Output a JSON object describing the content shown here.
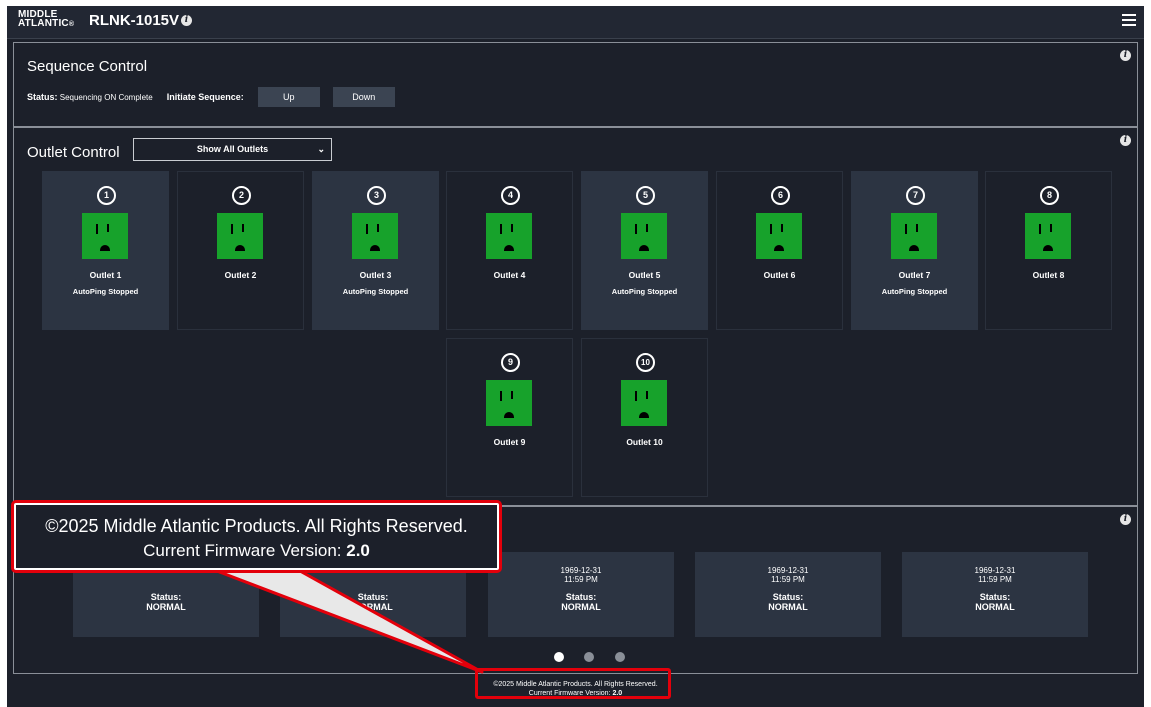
{
  "header": {
    "logo_line1": "MIDDLE",
    "logo_line2": "ATLANTIC",
    "logo_suffix": "®",
    "device_name": "RLNK-1015V"
  },
  "sequence": {
    "title": "Sequence Control",
    "status_label": "Status:",
    "status_value": "Sequencing ON Complete",
    "initiate_label": "Initiate Sequence:",
    "up_label": "Up",
    "down_label": "Down"
  },
  "outlet_control": {
    "title": "Outlet Control",
    "filter_selected": "Show All Outlets",
    "outlets": [
      {
        "num": "1",
        "name": "Outlet 1",
        "status": "AutoPing Stopped"
      },
      {
        "num": "2",
        "name": "Outlet 2",
        "status": ""
      },
      {
        "num": "3",
        "name": "Outlet 3",
        "status": "AutoPing Stopped"
      },
      {
        "num": "4",
        "name": "Outlet 4",
        "status": ""
      },
      {
        "num": "5",
        "name": "Outlet 5",
        "status": "AutoPing Stopped"
      },
      {
        "num": "6",
        "name": "Outlet 6",
        "status": ""
      },
      {
        "num": "7",
        "name": "Outlet 7",
        "status": "AutoPing Stopped"
      },
      {
        "num": "8",
        "name": "Outlet 8",
        "status": ""
      },
      {
        "num": "9",
        "name": "Outlet 9",
        "status": ""
      },
      {
        "num": "10",
        "name": "Outlet 10",
        "status": ""
      }
    ],
    "socket_color": "#17a22b"
  },
  "timers": {
    "cards": [
      {
        "date": "",
        "time": "",
        "status_label": "Status:",
        "status_value": "NORMAL"
      },
      {
        "date": "",
        "time": "",
        "status_label": "Status:",
        "status_value": "NORMAL"
      },
      {
        "date": "1969-12-31",
        "time": "11:59 PM",
        "status_label": "Status:",
        "status_value": "NORMAL"
      },
      {
        "date": "1969-12-31",
        "time": "11:59 PM",
        "status_label": "Status:",
        "status_value": "NORMAL"
      },
      {
        "date": "1969-12-31",
        "time": "11:59 PM",
        "status_label": "Status:",
        "status_value": "NORMAL"
      }
    ],
    "pages": 3,
    "active_page": 1
  },
  "footer": {
    "copyright": "©2025 Middle Atlantic Products. All Rights Reserved.",
    "firmware_label": "Current Firmware Version:",
    "firmware_version": "2.0"
  },
  "callout": {
    "line1": "©2025 Middle Atlantic Products. All Rights Reserved.",
    "firmware_label": "Current Firmware Version:",
    "firmware_version": "2.0"
  },
  "colors": {
    "background": "#1c202a",
    "tile_dark": "#2c3442",
    "button": "#3b4452",
    "highlight": "#e3000b"
  }
}
